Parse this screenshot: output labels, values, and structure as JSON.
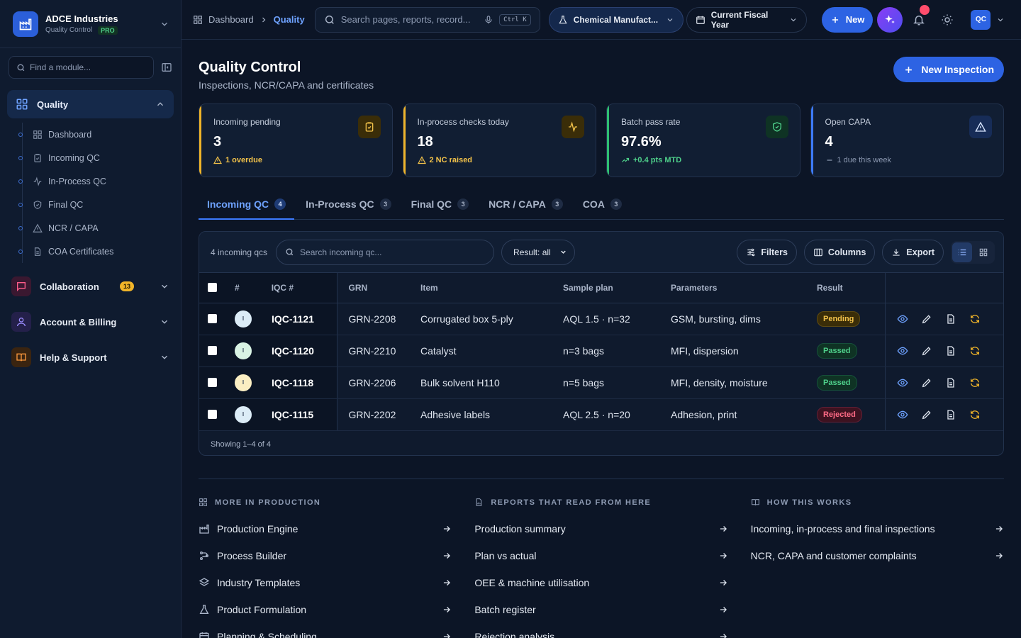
{
  "brand": {
    "name": "ADCE Industries",
    "sub": "Quality Control",
    "badge": "PRO"
  },
  "sidebar": {
    "find_placeholder": "Find a module...",
    "active_group": "Quality",
    "items": [
      {
        "label": "Dashboard",
        "icon": "grid-icon"
      },
      {
        "label": "Incoming QC",
        "icon": "clipboard-icon"
      },
      {
        "label": "In-Process QC",
        "icon": "activity-icon"
      },
      {
        "label": "Final QC",
        "icon": "shield-check-icon"
      },
      {
        "label": "NCR / CAPA",
        "icon": "warning-icon"
      },
      {
        "label": "COA Certificates",
        "icon": "document-icon"
      }
    ],
    "groups": [
      {
        "label": "Collaboration",
        "badge": "13"
      },
      {
        "label": "Account & Billing"
      },
      {
        "label": "Help & Support"
      }
    ]
  },
  "topbar": {
    "crumb_root": "Dashboard",
    "crumb_current": "Quality",
    "search_placeholder": "Search pages, reports, record...",
    "shortcut": "Ctrl K",
    "industry": "Chemical Manufact...",
    "period": "Current Fiscal Year",
    "new_label": "New",
    "avatar": "QC",
    "colors": {
      "accent": "#2d63e3",
      "notification": "#ff4d6d"
    }
  },
  "page": {
    "title": "Quality Control",
    "subtitle": "Inspections, NCR/CAPA and certificates",
    "new_inspection": "New Inspection"
  },
  "kpis": [
    {
      "label": "Incoming pending",
      "value": "3",
      "note": "1 overdue",
      "color": "#f0b429"
    },
    {
      "label": "In-process checks today",
      "value": "18",
      "note": "2 NC raised",
      "color": "#f0b429"
    },
    {
      "label": "Batch pass rate",
      "value": "97.6%",
      "note": "+0.4 pts MTD",
      "color": "#2fbf71"
    },
    {
      "label": "Open CAPA",
      "value": "4",
      "note": "1 due this week",
      "color": "#3d7bff"
    }
  ],
  "tabs": [
    {
      "label": "Incoming QC",
      "count": "4"
    },
    {
      "label": "In-Process QC",
      "count": "3"
    },
    {
      "label": "Final QC",
      "count": "3"
    },
    {
      "label": "NCR / CAPA",
      "count": "3"
    },
    {
      "label": "COA",
      "count": "3"
    }
  ],
  "table": {
    "count_label": "4 incoming qcs",
    "search_placeholder": "Search incoming qc...",
    "result_filter": "Result: all",
    "filters": "Filters",
    "columns": "Columns",
    "export": "Export",
    "headers": [
      "#",
      "IQC #",
      "GRN",
      "Item",
      "Sample plan",
      "Parameters",
      "Result"
    ],
    "rows": [
      {
        "avatar": "I",
        "id": "IQC-1121",
        "grn": "GRN-2208",
        "item": "Corrugated box 5-ply",
        "plan": "AQL 1.5 · n=32",
        "params": "GSM, bursting, dims",
        "result": "Pending"
      },
      {
        "avatar": "I",
        "id": "IQC-1120",
        "grn": "GRN-2210",
        "item": "Catalyst",
        "plan": "n=3 bags",
        "params": "MFI, dispersion",
        "result": "Passed"
      },
      {
        "avatar": "I",
        "id": "IQC-1118",
        "grn": "GRN-2206",
        "item": "Bulk solvent H110",
        "plan": "n=5 bags",
        "params": "MFI, density, moisture",
        "result": "Passed"
      },
      {
        "avatar": "I",
        "id": "IQC-1115",
        "grn": "GRN-2202",
        "item": "Adhesive labels",
        "plan": "AQL 2.5 · n=20",
        "params": "Adhesion, print",
        "result": "Rejected"
      }
    ],
    "footer": "Showing 1–4 of 4"
  },
  "more": {
    "production": {
      "heading": "More in Production",
      "links": [
        "Production Engine",
        "Process Builder",
        "Industry Templates",
        "Product Formulation",
        "Planning & Scheduling"
      ]
    },
    "reports": {
      "heading": "Reports that read from here",
      "links": [
        "Production summary",
        "Plan vs actual",
        "OEE & machine utilisation",
        "Batch register",
        "Rejection analysis"
      ]
    },
    "how": {
      "heading": "How this works",
      "links": [
        "Incoming, in-process and final inspections",
        "NCR, CAPA and customer complaints"
      ]
    }
  }
}
